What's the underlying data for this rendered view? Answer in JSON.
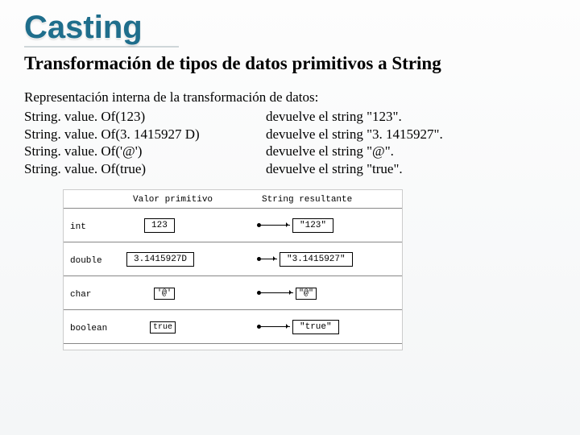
{
  "title": "Casting",
  "subtitle": "Transformación de tipos de datos primitivos a String",
  "intro": "Representación interna de la transformación de datos:",
  "examples": [
    {
      "code": "String. value. Of(123)",
      "result": "devuelve el string \"123\"."
    },
    {
      "code": "String. value. Of(3. 1415927 D)",
      "result": "devuelve el string \"3. 1415927\"."
    },
    {
      "code": "String. value. Of('@')",
      "result": "devuelve el string \"@\"."
    },
    {
      "code": "String. value. Of(true)",
      "result": "devuelve el string \"true\"."
    }
  ],
  "diagram": {
    "header_left": "Valor primitivo",
    "header_right": "String resultante",
    "rows": [
      {
        "type": "int",
        "prim": "123",
        "str": "\"123\""
      },
      {
        "type": "double",
        "prim": "3.1415927D",
        "str": "\"3.1415927\""
      },
      {
        "type": "char",
        "prim": "'@'",
        "str": "\"@\""
      },
      {
        "type": "boolean",
        "prim": "true",
        "str": "\"true\""
      }
    ]
  }
}
